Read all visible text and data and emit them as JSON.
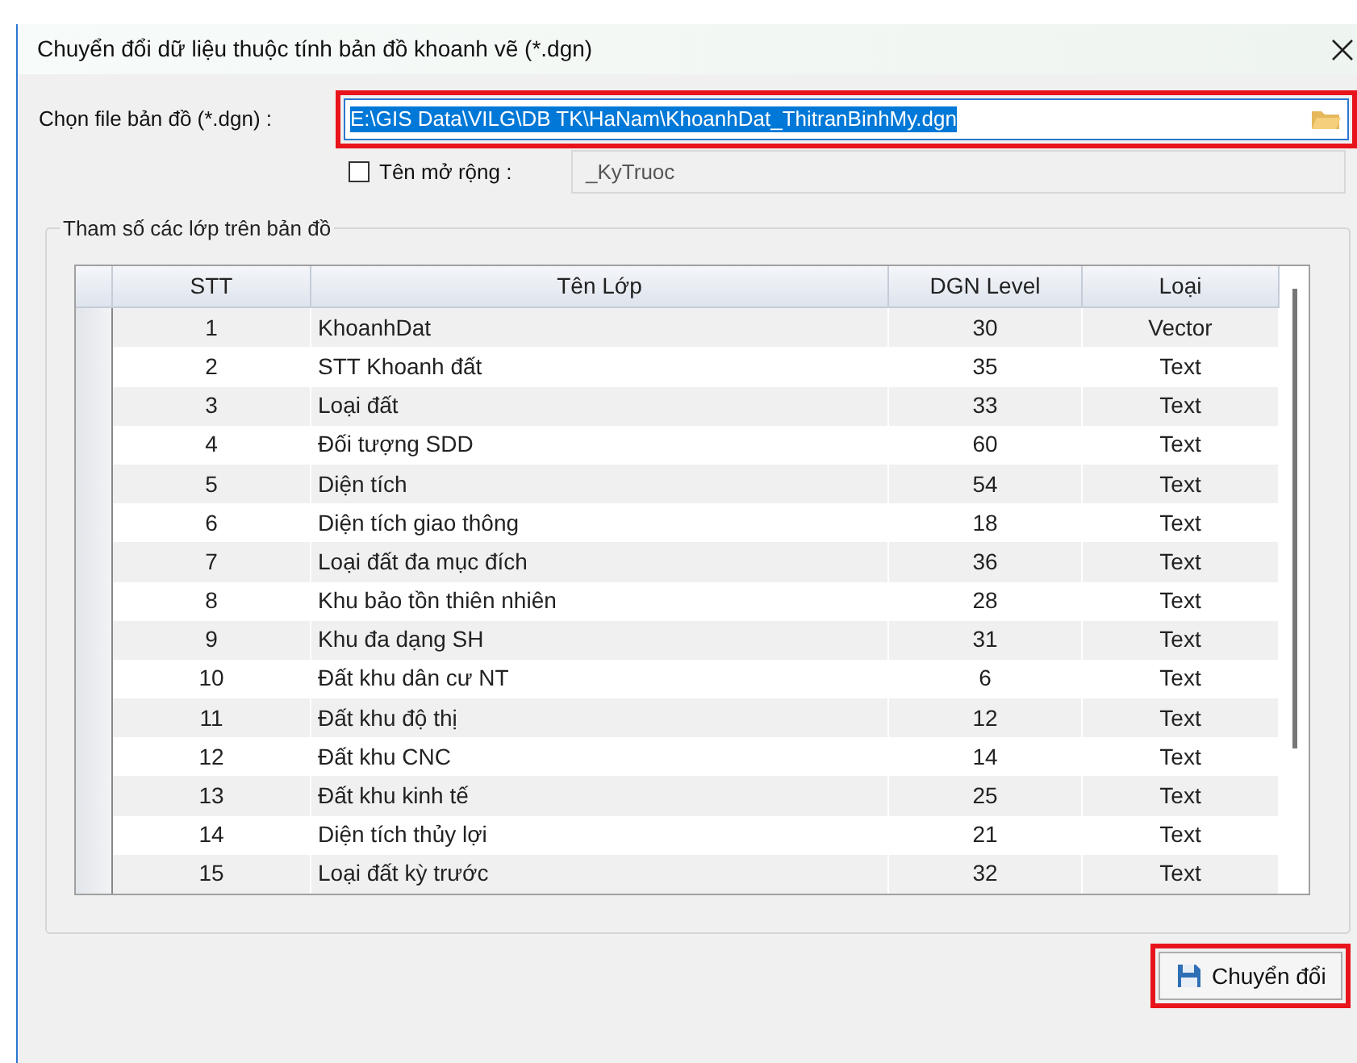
{
  "window": {
    "title": "Chuyển đổi dữ liệu thuộc tính bản đồ khoanh vẽ (*.dgn)"
  },
  "file_field": {
    "label": "Chọn file bản đồ (*.dgn) :",
    "value": "E:\\GIS Data\\VILG\\DB TK\\HaNam\\KhoanhDat_ThitranBinhMy.dgn",
    "highlighted": true
  },
  "extension": {
    "label": "Tên mở rộng :",
    "checked": false,
    "value": "_KyTruoc"
  },
  "group": {
    "title": "Tham số các lớp trên bản đồ"
  },
  "table": {
    "columns": [
      "STT",
      "Tên Lớp",
      "DGN Level",
      "Loại"
    ],
    "rows": [
      [
        "1",
        "KhoanhDat",
        "30",
        "Vector"
      ],
      [
        "2",
        "STT Khoanh đất",
        "35",
        "Text"
      ],
      [
        "3",
        "Loại đất",
        "33",
        "Text"
      ],
      [
        "4",
        "Đối tượng SDD",
        "60",
        "Text"
      ],
      [
        "5",
        "Diện tích",
        "54",
        "Text"
      ],
      [
        "6",
        "Diện tích giao thông",
        "18",
        "Text"
      ],
      [
        "7",
        "Loại đất đa mục đích",
        "36",
        "Text"
      ],
      [
        "8",
        "Khu bảo tồn thiên nhiên",
        "28",
        "Text"
      ],
      [
        "9",
        "Khu đa dạng SH",
        "31",
        "Text"
      ],
      [
        "10",
        "Đất khu dân cư NT",
        "6",
        "Text"
      ],
      [
        "11",
        "Đất khu độ thị",
        "12",
        "Text"
      ],
      [
        "12",
        "Đất khu CNC",
        "14",
        "Text"
      ],
      [
        "13",
        "Đất khu kinh tế",
        "25",
        "Text"
      ],
      [
        "14",
        "Diện tích thủy lợi",
        "21",
        "Text"
      ],
      [
        "15",
        "Loại đất kỳ trước",
        "32",
        "Text"
      ]
    ]
  },
  "convert_button": {
    "label": "Chuyển đổi",
    "highlighted": true
  }
}
